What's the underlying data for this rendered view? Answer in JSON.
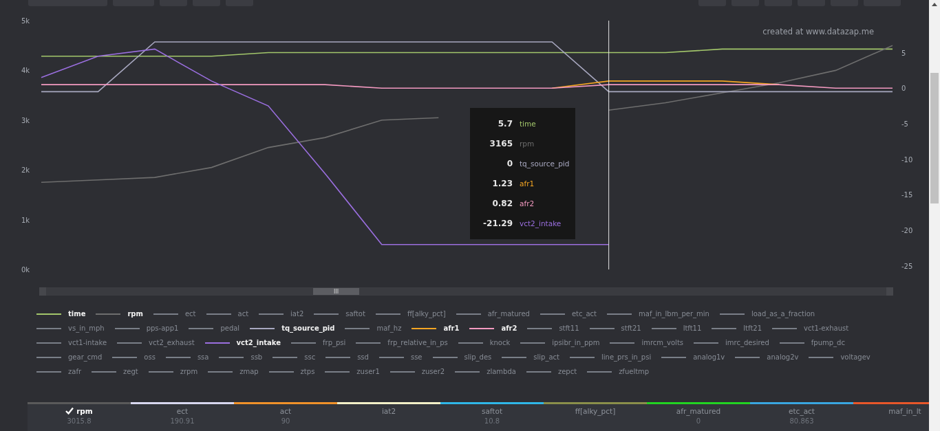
{
  "chart": {
    "credit": "created at www.datazap.me",
    "chart_data": {
      "type": "line",
      "ylim": [
        0,
        5000
      ],
      "yticks": [
        {
          "value": 0,
          "label": "0k"
        },
        {
          "value": 1000,
          "label": "1k"
        },
        {
          "value": 2000,
          "label": "2k"
        },
        {
          "value": 3000,
          "label": "3k"
        },
        {
          "value": 4000,
          "label": "4k"
        },
        {
          "value": 5000,
          "label": "5k"
        }
      ],
      "y2lim": [
        -25.5,
        9.5
      ],
      "y2ticks": [
        {
          "value": 5,
          "label": "5"
        },
        {
          "value": 0,
          "label": "0"
        },
        {
          "value": -5,
          "label": "-5"
        },
        {
          "value": -10,
          "label": "-10"
        },
        {
          "value": -15,
          "label": "-15"
        },
        {
          "value": -20,
          "label": "-20"
        },
        {
          "value": -25,
          "label": "-25"
        }
      ],
      "series": [
        {
          "color": "#a3c76b",
          "axis": "y2",
          "values": [
            4.5,
            4.5,
            4.5,
            4.5,
            5,
            5,
            5,
            5,
            5,
            5,
            5,
            5,
            5.5,
            5.5,
            5.5,
            5.5
          ]
        },
        {
          "color": "#6e6e6e",
          "values": [
            1750,
            1800,
            1850,
            2050,
            2450,
            2650,
            3000,
            3050,
            null,
            null,
            3200,
            3350,
            3550,
            3750,
            4000,
            4500
          ]
        },
        {
          "color": "#a8a8c0",
          "axis": "y2",
          "values": [
            -0.5,
            -0.5,
            6.5,
            6.5,
            6.5,
            6.5,
            6.5,
            6.5,
            6.5,
            6.5,
            -0.5,
            -0.5,
            -0.5,
            -0.5,
            -0.5,
            -0.5
          ]
        },
        {
          "color": "#f5a623",
          "axis": "y2",
          "values": [
            null,
            null,
            null,
            null,
            null,
            null,
            null,
            null,
            null,
            0,
            1,
            1,
            1,
            0.5,
            null,
            null
          ]
        },
        {
          "color": "#f49ac1",
          "axis": "y2",
          "values": [
            0.5,
            0.5,
            0.5,
            0.5,
            0.5,
            0.5,
            0,
            0,
            0,
            0,
            0.5,
            0.5,
            0.5,
            0.5,
            0,
            0
          ]
        },
        {
          "color": "#9b6fe0",
          "axis": "y2",
          "values": [
            1.5,
            4.5,
            5.5,
            1,
            -2.5,
            -12,
            -22,
            -22,
            -22,
            -22,
            -22,
            null,
            null,
            null,
            null,
            null
          ]
        }
      ]
    },
    "tooltip": [
      {
        "value": "5.7",
        "name": "time",
        "color": "#a3c76b"
      },
      {
        "value": "3165",
        "name": "rpm",
        "color": "#6e6e6e"
      },
      {
        "value": "0",
        "name": "tq_source_pid",
        "color": "#a8a8c0"
      },
      {
        "value": "1.23",
        "name": "afr1",
        "color": "#f5a623"
      },
      {
        "value": "0.82",
        "name": "afr2",
        "color": "#f49ac1"
      },
      {
        "value": "-21.29",
        "name": "vct2_intake",
        "color": "#9b6fe0"
      }
    ],
    "scroll_grip": "III"
  },
  "legend": [
    {
      "label": "time",
      "selected": true,
      "color": "#a3c76b"
    },
    {
      "label": "rpm",
      "selected": true,
      "color": "#6e6e6e"
    },
    {
      "label": "ect",
      "selected": false,
      "color": "#7a7f88"
    },
    {
      "label": "act",
      "selected": false,
      "color": "#7a7f88"
    },
    {
      "label": "iat2",
      "selected": false,
      "color": "#7a7f88"
    },
    {
      "label": "saftot",
      "selected": false,
      "color": "#7a7f88"
    },
    {
      "label": "ff[alky_pct]",
      "selected": false,
      "color": "#7a7f88"
    },
    {
      "label": "afr_matured",
      "selected": false,
      "color": "#7a7f88"
    },
    {
      "label": "etc_act",
      "selected": false,
      "color": "#7a7f88"
    },
    {
      "label": "maf_in_lbm_per_min",
      "selected": false,
      "color": "#7a7f88"
    },
    {
      "label": "load_as_a_fraction",
      "selected": false,
      "color": "#7a7f88"
    },
    {
      "label": "vs_in_mph",
      "selected": false,
      "color": "#7a7f88"
    },
    {
      "label": "pps-app1",
      "selected": false,
      "color": "#7a7f88"
    },
    {
      "label": "pedal",
      "selected": false,
      "color": "#7a7f88"
    },
    {
      "label": "tq_source_pid",
      "selected": true,
      "color": "#a8a8c0"
    },
    {
      "label": "maf_hz",
      "selected": false,
      "color": "#7a7f88"
    },
    {
      "label": "afr1",
      "selected": true,
      "color": "#f5a623"
    },
    {
      "label": "afr2",
      "selected": true,
      "color": "#f49ac1"
    },
    {
      "label": "stft11",
      "selected": false,
      "color": "#7a7f88"
    },
    {
      "label": "stft21",
      "selected": false,
      "color": "#7a7f88"
    },
    {
      "label": "ltft11",
      "selected": false,
      "color": "#7a7f88"
    },
    {
      "label": "ltft21",
      "selected": false,
      "color": "#7a7f88"
    },
    {
      "label": "vct1-exhaust",
      "selected": false,
      "color": "#7a7f88"
    },
    {
      "label": "vct1-intake",
      "selected": false,
      "color": "#7a7f88"
    },
    {
      "label": "vct2_exhaust",
      "selected": false,
      "color": "#7a7f88"
    },
    {
      "label": "vct2_intake",
      "selected": true,
      "color": "#9b6fe0"
    },
    {
      "label": "frp_psi",
      "selected": false,
      "color": "#7a7f88"
    },
    {
      "label": "frp_relative_in_ps",
      "selected": false,
      "color": "#7a7f88"
    },
    {
      "label": "knock",
      "selected": false,
      "color": "#7a7f88"
    },
    {
      "label": "ipsibr_in_ppm",
      "selected": false,
      "color": "#7a7f88"
    },
    {
      "label": "imrcm_volts",
      "selected": false,
      "color": "#7a7f88"
    },
    {
      "label": "imrc_desired",
      "selected": false,
      "color": "#7a7f88"
    },
    {
      "label": "fpump_dc",
      "selected": false,
      "color": "#7a7f88"
    },
    {
      "label": "gear_cmd",
      "selected": false,
      "color": "#7a7f88"
    },
    {
      "label": "oss",
      "selected": false,
      "color": "#7a7f88"
    },
    {
      "label": "ssa",
      "selected": false,
      "color": "#7a7f88"
    },
    {
      "label": "ssb",
      "selected": false,
      "color": "#7a7f88"
    },
    {
      "label": "ssc",
      "selected": false,
      "color": "#7a7f88"
    },
    {
      "label": "ssd",
      "selected": false,
      "color": "#7a7f88"
    },
    {
      "label": "sse",
      "selected": false,
      "color": "#7a7f88"
    },
    {
      "label": "slip_des",
      "selected": false,
      "color": "#7a7f88"
    },
    {
      "label": "slip_act",
      "selected": false,
      "color": "#7a7f88"
    },
    {
      "label": "line_prs_in_psi",
      "selected": false,
      "color": "#7a7f88"
    },
    {
      "label": "analog1v",
      "selected": false,
      "color": "#7a7f88"
    },
    {
      "label": "analog2v",
      "selected": false,
      "color": "#7a7f88"
    },
    {
      "label": "voltagev",
      "selected": false,
      "color": "#7a7f88"
    },
    {
      "label": "zafr",
      "selected": false,
      "color": "#7a7f88"
    },
    {
      "label": "zegt",
      "selected": false,
      "color": "#7a7f88"
    },
    {
      "label": "zrpm",
      "selected": false,
      "color": "#7a7f88"
    },
    {
      "label": "zmap",
      "selected": false,
      "color": "#7a7f88"
    },
    {
      "label": "ztps",
      "selected": false,
      "color": "#7a7f88"
    },
    {
      "label": "zuser1",
      "selected": false,
      "color": "#7a7f88"
    },
    {
      "label": "zuser2",
      "selected": false,
      "color": "#7a7f88"
    },
    {
      "label": "zlambda",
      "selected": false,
      "color": "#7a7f88"
    },
    {
      "label": "zepct",
      "selected": false,
      "color": "#7a7f88"
    },
    {
      "label": "zfueltmp",
      "selected": false,
      "color": "#7a7f88"
    }
  ],
  "table": {
    "columns": [
      {
        "name": "rpm",
        "value": "3015.8",
        "selected": true,
        "color": "#5a5a5a"
      },
      {
        "name": "ect",
        "value": "190.91",
        "selected": false,
        "color": "#d8d8f0"
      },
      {
        "name": "act",
        "value": "90",
        "selected": false,
        "color": "#f0922a"
      },
      {
        "name": "iat2",
        "selected": false,
        "color": "#f3f0c8"
      },
      {
        "name": "saftot",
        "value": "10.8",
        "selected": false,
        "color": "#2fb7e8"
      },
      {
        "name": "ff[alky_pct]",
        "selected": false,
        "color": "#8a8f4a"
      },
      {
        "name": "afr_matured",
        "value": "0",
        "selected": false,
        "color": "#22d422"
      },
      {
        "name": "etc_act",
        "value": "80.863",
        "selected": false,
        "color": "#3aa6e0"
      },
      {
        "name": "maf_in_lt",
        "selected": false,
        "color": "#e8572a"
      }
    ]
  }
}
